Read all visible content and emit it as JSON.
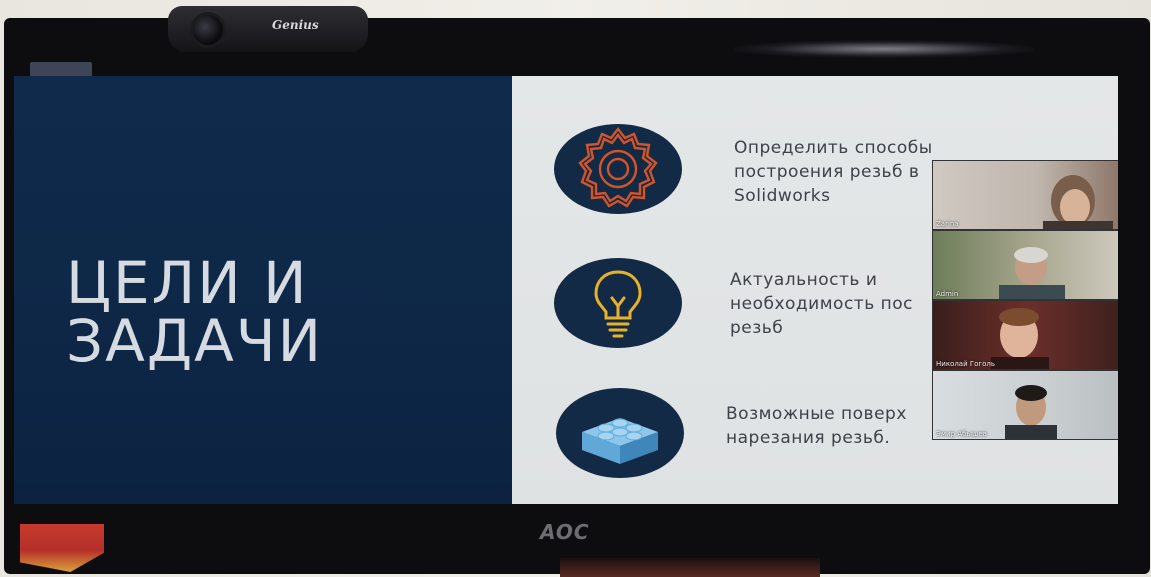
{
  "webcam": {
    "brand": "Genius"
  },
  "slide": {
    "title_lines": [
      "ЦЕЛИ И",
      "ЗАДАЧИ"
    ],
    "goals": [
      {
        "icon": "gear-icon",
        "text": "Определить способы\nпостроения резьб в\nSolidworks"
      },
      {
        "icon": "lightbulb-icon",
        "text": "Актуальность и\nнеобходимость пос\nрезьб"
      },
      {
        "icon": "lego-brick-icon",
        "text": "Возможные поверх\nнарезания резьб."
      }
    ]
  },
  "participants": [
    {
      "name": "Zarina"
    },
    {
      "name": "Admin"
    },
    {
      "name": "Николай Гоголь"
    },
    {
      "name": "Эмир Абышев"
    }
  ],
  "monitor": {
    "brand": "AOC"
  },
  "colors": {
    "slide_dark": "#0f2a4b",
    "slide_light": "#e2e5e6",
    "gear_orange": "#d2552a",
    "bulb_yellow": "#e8b12a",
    "brick_blue": "#5fa8d8"
  }
}
